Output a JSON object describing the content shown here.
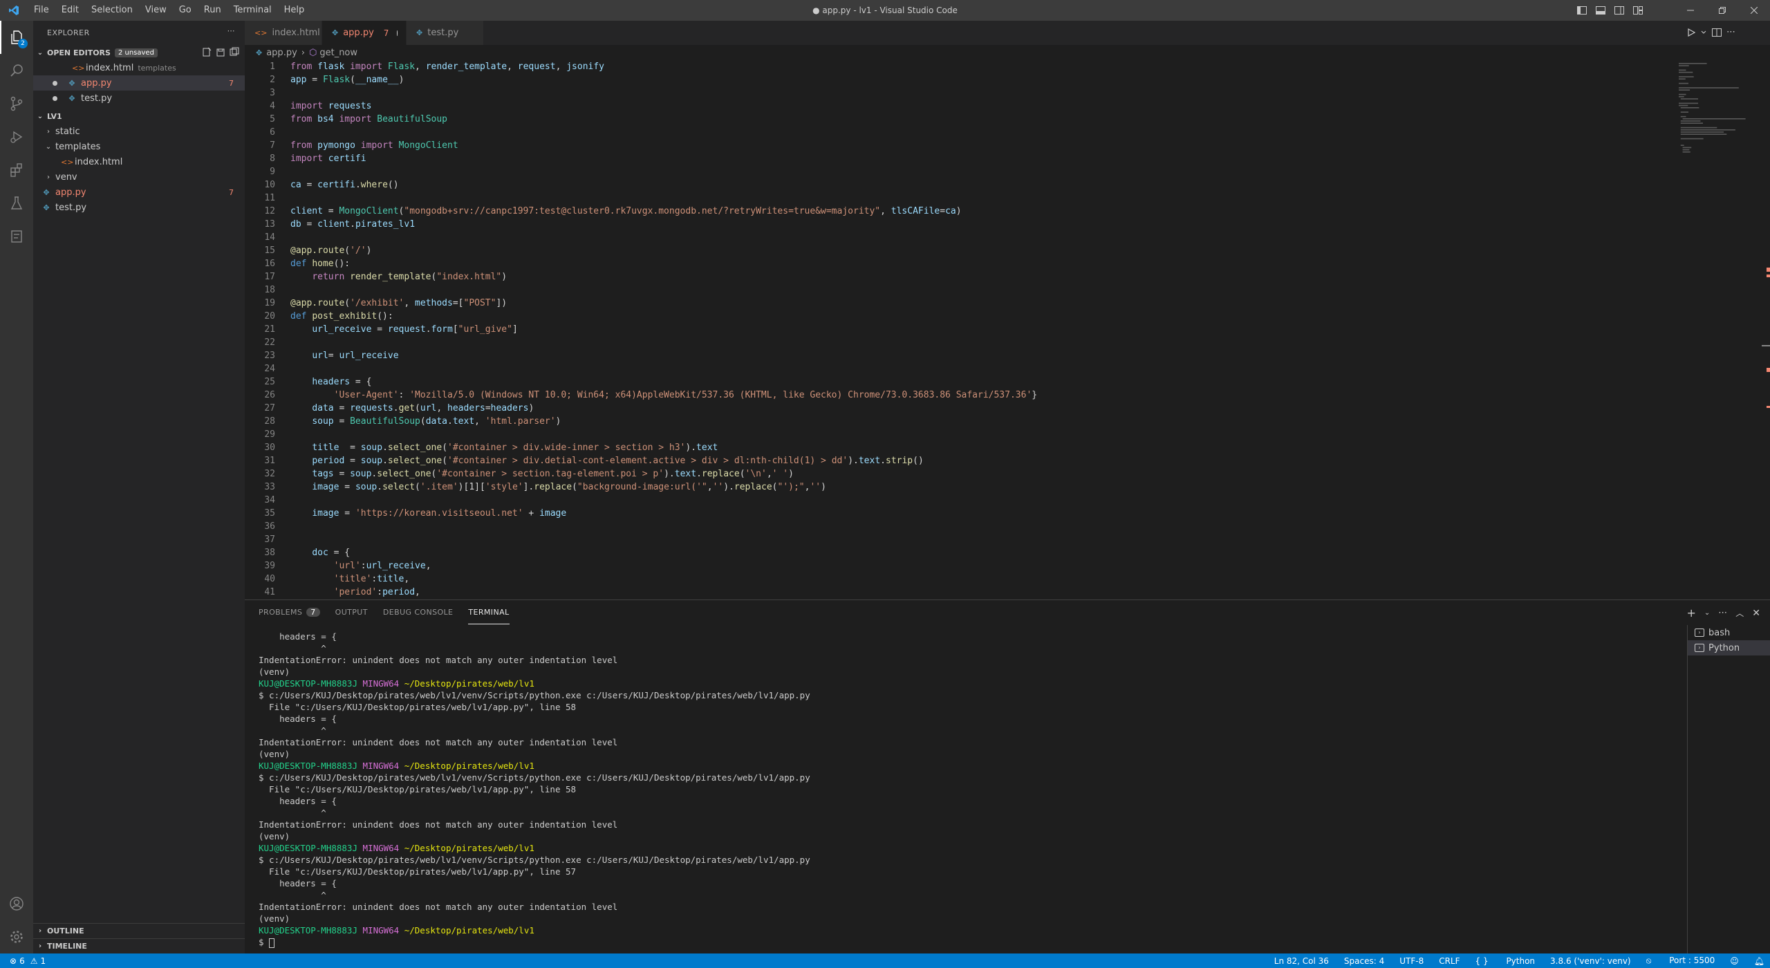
{
  "window": {
    "title": "● app.py - lv1 - Visual Studio Code"
  },
  "menu": [
    "File",
    "Edit",
    "Selection",
    "View",
    "Go",
    "Run",
    "Terminal",
    "Help"
  ],
  "activity": {
    "explorer_badge": "2"
  },
  "sidebar": {
    "title": "EXPLORER",
    "open_editors": {
      "label": "OPEN EDITORS",
      "unsaved": "2 unsaved",
      "items": [
        {
          "name": "index.html",
          "hint": "templates"
        },
        {
          "name": "app.py",
          "count": "7"
        },
        {
          "name": "test.py"
        }
      ]
    },
    "workspace": {
      "label": "LV1",
      "items": [
        {
          "name": "static"
        },
        {
          "name": "templates"
        },
        {
          "name": "index.html"
        },
        {
          "name": "venv"
        },
        {
          "name": "app.py",
          "count": "7"
        },
        {
          "name": "test.py"
        }
      ]
    },
    "outline": "OUTLINE",
    "timeline": "TIMELINE"
  },
  "tabs": [
    {
      "name": "index.html"
    },
    {
      "name": "app.py",
      "count": "7"
    },
    {
      "name": "test.py"
    }
  ],
  "breadcrumb": {
    "file": "app.py",
    "symbol": "get_now"
  },
  "editor": {
    "lines": [
      "from flask import Flask, render_template, request, jsonify",
      "app = Flask(__name__)",
      "",
      "import requests",
      "from bs4 import BeautifulSoup",
      "",
      "from pymongo import MongoClient",
      "import certifi",
      "",
      "ca = certifi.where()",
      "",
      "client = MongoClient(\"mongodb+srv://canpc1997:test@cluster0.rk7uvgx.mongodb.net/?retryWrites=true&w=majority\", tlsCAFile=ca)",
      "db = client.pirates_lv1",
      "",
      "@app.route('/')",
      "def home():",
      "    return render_template(\"index.html\")",
      "",
      "@app.route('/exhibit', methods=[\"POST\"])",
      "def post_exhibit():",
      "    url_receive = request.form[\"url_give\"]",
      "",
      "    url= url_receive",
      "",
      "    headers = {",
      "        'User-Agent': 'Mozilla/5.0 (Windows NT 10.0; Win64; x64)AppleWebKit/537.36 (KHTML, like Gecko) Chrome/73.0.3683.86 Safari/537.36'}",
      "    data = requests.get(url, headers=headers)",
      "    soup = BeautifulSoup(data.text, 'html.parser')",
      "",
      "    title  = soup.select_one('#container > div.wide-inner > section > h3').text",
      "    period = soup.select_one('#container > div.detial-cont-element.active > div > dl:nth-child(1) > dd').text.strip()",
      "    tags = soup.select_one('#container > section.tag-element.poi > p').text.replace('\\n',' ')",
      "    image = soup.select('.item')[1]['style'].replace(\"background-image:url('\",'').replace(\"');\",'')",
      "",
      "    image = 'https://korean.visitseoul.net' + image",
      "",
      "",
      "    doc = {",
      "        'url':url_receive,",
      "        'title':title,",
      "        'period':period,"
    ]
  },
  "panel": {
    "tabs": [
      {
        "label": "PROBLEMS",
        "badge": "7"
      },
      {
        "label": "OUTPUT"
      },
      {
        "label": "DEBUG CONSOLE"
      },
      {
        "label": "TERMINAL"
      }
    ],
    "terminal_lines": [
      {
        "type": "plain",
        "text": "    headers = {"
      },
      {
        "type": "plain",
        "text": "            ^"
      },
      {
        "type": "plain",
        "text": "IndentationError: unindent does not match any outer indentation level"
      },
      {
        "type": "plain",
        "text": "(venv)"
      },
      {
        "type": "prompt",
        "user": "KUJ@DESKTOP-MH8883J",
        "sys": "MINGW64",
        "path": "~/Desktop/pirates/web/lv1"
      },
      {
        "type": "plain",
        "text": "$ c:/Users/KUJ/Desktop/pirates/web/lv1/venv/Scripts/python.exe c:/Users/KUJ/Desktop/pirates/web/lv1/app.py"
      },
      {
        "type": "plain",
        "text": "  File \"c:/Users/KUJ/Desktop/pirates/web/lv1/app.py\", line 58"
      },
      {
        "type": "plain",
        "text": "    headers = {"
      },
      {
        "type": "plain",
        "text": "            ^"
      },
      {
        "type": "plain",
        "text": "IndentationError: unindent does not match any outer indentation level"
      },
      {
        "type": "plain",
        "text": "(venv)"
      },
      {
        "type": "prompt",
        "user": "KUJ@DESKTOP-MH8883J",
        "sys": "MINGW64",
        "path": "~/Desktop/pirates/web/lv1"
      },
      {
        "type": "plain",
        "text": "$ c:/Users/KUJ/Desktop/pirates/web/lv1/venv/Scripts/python.exe c:/Users/KUJ/Desktop/pirates/web/lv1/app.py"
      },
      {
        "type": "plain",
        "text": "  File \"c:/Users/KUJ/Desktop/pirates/web/lv1/app.py\", line 58"
      },
      {
        "type": "plain",
        "text": "    headers = {"
      },
      {
        "type": "plain",
        "text": "            ^"
      },
      {
        "type": "plain",
        "text": "IndentationError: unindent does not match any outer indentation level"
      },
      {
        "type": "plain",
        "text": "(venv)"
      },
      {
        "type": "prompt",
        "user": "KUJ@DESKTOP-MH8883J",
        "sys": "MINGW64",
        "path": "~/Desktop/pirates/web/lv1"
      },
      {
        "type": "plain",
        "text": "$ c:/Users/KUJ/Desktop/pirates/web/lv1/venv/Scripts/python.exe c:/Users/KUJ/Desktop/pirates/web/lv1/app.py"
      },
      {
        "type": "plain",
        "text": "  File \"c:/Users/KUJ/Desktop/pirates/web/lv1/app.py\", line 57"
      },
      {
        "type": "plain",
        "text": "    headers = {"
      },
      {
        "type": "plain",
        "text": "            ^"
      },
      {
        "type": "plain",
        "text": "IndentationError: unindent does not match any outer indentation level"
      },
      {
        "type": "plain",
        "text": "(venv)"
      },
      {
        "type": "prompt",
        "user": "KUJ@DESKTOP-MH8883J",
        "sys": "MINGW64",
        "path": "~/Desktop/pirates/web/lv1"
      },
      {
        "type": "cursor",
        "text": "$ "
      }
    ],
    "terminals": [
      "bash",
      "Python"
    ]
  },
  "status": {
    "errors": "6",
    "warnings": "1",
    "position": "Ln 82, Col 36",
    "spaces": "Spaces: 4",
    "encoding": "UTF-8",
    "eol": "CRLF",
    "language": "Python",
    "interpreter": "3.8.6 ('venv': venv)",
    "port": "Port : 5500"
  },
  "colors": {
    "accent": "#007acc",
    "error": "#f48771",
    "titlebar": "#3c3c3c"
  }
}
